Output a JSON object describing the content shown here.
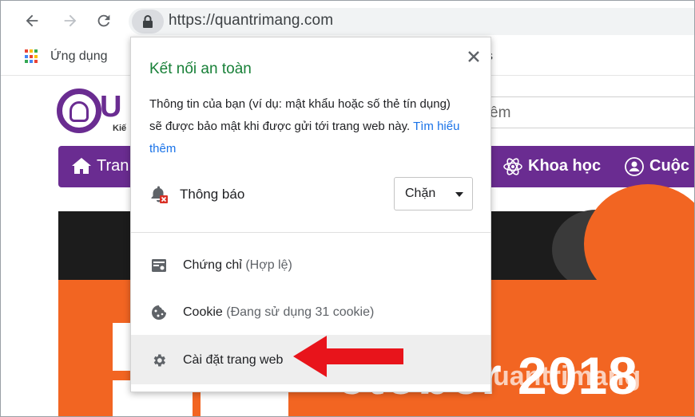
{
  "browser": {
    "url": "https://quantrimang.com",
    "bookmarks_label": "Ứng dụng",
    "hidden_bookmark_fragment": "s"
  },
  "page": {
    "search_fragment": "êm",
    "logo_letter": "U",
    "logo_tagline": "Kiế",
    "nav": {
      "home": "Tran",
      "science": "Khoa học",
      "life": "Cuộc s"
    },
    "banner_text": "ctober 2018",
    "watermark": "uantrimang"
  },
  "popup": {
    "title": "Kết nối an toàn",
    "description": "Thông tin của bạn (ví dụ: mật khẩu hoặc số thẻ tín dụng) sẽ được bảo mật khi được gửi tới trang web này.",
    "learn_more": "Tìm hiểu thêm",
    "notification_label": "Thông báo",
    "notification_value": "Chặn",
    "certificate_label": "Chứng chỉ",
    "certificate_status": "(Hợp lệ)",
    "cookie_label": "Cookie",
    "cookie_status": "(Đang sử dụng 31 cookie)",
    "site_settings_label": "Cài đặt trang web"
  },
  "colors": {
    "secure_green": "#188038",
    "link_blue": "#1a73e8",
    "brand_purple": "#6a2c91",
    "banner_orange": "#f26522",
    "arrow_red": "#e8141b"
  },
  "icons": [
    "back-arrow-icon",
    "forward-arrow-icon",
    "reload-icon",
    "lock-icon",
    "apps-grid-icon",
    "close-icon",
    "bell-blocked-icon",
    "certificate-icon",
    "cookie-icon",
    "gear-icon",
    "home-icon",
    "atom-icon",
    "life-icon"
  ]
}
